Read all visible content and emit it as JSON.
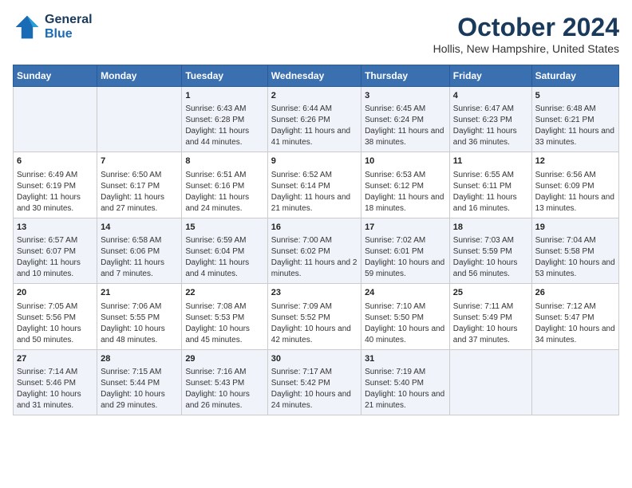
{
  "header": {
    "logo_line1": "General",
    "logo_line2": "Blue",
    "title": "October 2024",
    "location": "Hollis, New Hampshire, United States"
  },
  "days_of_week": [
    "Sunday",
    "Monday",
    "Tuesday",
    "Wednesday",
    "Thursday",
    "Friday",
    "Saturday"
  ],
  "weeks": [
    [
      {
        "day": "",
        "content": ""
      },
      {
        "day": "",
        "content": ""
      },
      {
        "day": "1",
        "content": "Sunrise: 6:43 AM\nSunset: 6:28 PM\nDaylight: 11 hours and 44 minutes."
      },
      {
        "day": "2",
        "content": "Sunrise: 6:44 AM\nSunset: 6:26 PM\nDaylight: 11 hours and 41 minutes."
      },
      {
        "day": "3",
        "content": "Sunrise: 6:45 AM\nSunset: 6:24 PM\nDaylight: 11 hours and 38 minutes."
      },
      {
        "day": "4",
        "content": "Sunrise: 6:47 AM\nSunset: 6:23 PM\nDaylight: 11 hours and 36 minutes."
      },
      {
        "day": "5",
        "content": "Sunrise: 6:48 AM\nSunset: 6:21 PM\nDaylight: 11 hours and 33 minutes."
      }
    ],
    [
      {
        "day": "6",
        "content": "Sunrise: 6:49 AM\nSunset: 6:19 PM\nDaylight: 11 hours and 30 minutes."
      },
      {
        "day": "7",
        "content": "Sunrise: 6:50 AM\nSunset: 6:17 PM\nDaylight: 11 hours and 27 minutes."
      },
      {
        "day": "8",
        "content": "Sunrise: 6:51 AM\nSunset: 6:16 PM\nDaylight: 11 hours and 24 minutes."
      },
      {
        "day": "9",
        "content": "Sunrise: 6:52 AM\nSunset: 6:14 PM\nDaylight: 11 hours and 21 minutes."
      },
      {
        "day": "10",
        "content": "Sunrise: 6:53 AM\nSunset: 6:12 PM\nDaylight: 11 hours and 18 minutes."
      },
      {
        "day": "11",
        "content": "Sunrise: 6:55 AM\nSunset: 6:11 PM\nDaylight: 11 hours and 16 minutes."
      },
      {
        "day": "12",
        "content": "Sunrise: 6:56 AM\nSunset: 6:09 PM\nDaylight: 11 hours and 13 minutes."
      }
    ],
    [
      {
        "day": "13",
        "content": "Sunrise: 6:57 AM\nSunset: 6:07 PM\nDaylight: 11 hours and 10 minutes."
      },
      {
        "day": "14",
        "content": "Sunrise: 6:58 AM\nSunset: 6:06 PM\nDaylight: 11 hours and 7 minutes."
      },
      {
        "day": "15",
        "content": "Sunrise: 6:59 AM\nSunset: 6:04 PM\nDaylight: 11 hours and 4 minutes."
      },
      {
        "day": "16",
        "content": "Sunrise: 7:00 AM\nSunset: 6:02 PM\nDaylight: 11 hours and 2 minutes."
      },
      {
        "day": "17",
        "content": "Sunrise: 7:02 AM\nSunset: 6:01 PM\nDaylight: 10 hours and 59 minutes."
      },
      {
        "day": "18",
        "content": "Sunrise: 7:03 AM\nSunset: 5:59 PM\nDaylight: 10 hours and 56 minutes."
      },
      {
        "day": "19",
        "content": "Sunrise: 7:04 AM\nSunset: 5:58 PM\nDaylight: 10 hours and 53 minutes."
      }
    ],
    [
      {
        "day": "20",
        "content": "Sunrise: 7:05 AM\nSunset: 5:56 PM\nDaylight: 10 hours and 50 minutes."
      },
      {
        "day": "21",
        "content": "Sunrise: 7:06 AM\nSunset: 5:55 PM\nDaylight: 10 hours and 48 minutes."
      },
      {
        "day": "22",
        "content": "Sunrise: 7:08 AM\nSunset: 5:53 PM\nDaylight: 10 hours and 45 minutes."
      },
      {
        "day": "23",
        "content": "Sunrise: 7:09 AM\nSunset: 5:52 PM\nDaylight: 10 hours and 42 minutes."
      },
      {
        "day": "24",
        "content": "Sunrise: 7:10 AM\nSunset: 5:50 PM\nDaylight: 10 hours and 40 minutes."
      },
      {
        "day": "25",
        "content": "Sunrise: 7:11 AM\nSunset: 5:49 PM\nDaylight: 10 hours and 37 minutes."
      },
      {
        "day": "26",
        "content": "Sunrise: 7:12 AM\nSunset: 5:47 PM\nDaylight: 10 hours and 34 minutes."
      }
    ],
    [
      {
        "day": "27",
        "content": "Sunrise: 7:14 AM\nSunset: 5:46 PM\nDaylight: 10 hours and 31 minutes."
      },
      {
        "day": "28",
        "content": "Sunrise: 7:15 AM\nSunset: 5:44 PM\nDaylight: 10 hours and 29 minutes."
      },
      {
        "day": "29",
        "content": "Sunrise: 7:16 AM\nSunset: 5:43 PM\nDaylight: 10 hours and 26 minutes."
      },
      {
        "day": "30",
        "content": "Sunrise: 7:17 AM\nSunset: 5:42 PM\nDaylight: 10 hours and 24 minutes."
      },
      {
        "day": "31",
        "content": "Sunrise: 7:19 AM\nSunset: 5:40 PM\nDaylight: 10 hours and 21 minutes."
      },
      {
        "day": "",
        "content": ""
      },
      {
        "day": "",
        "content": ""
      }
    ]
  ]
}
